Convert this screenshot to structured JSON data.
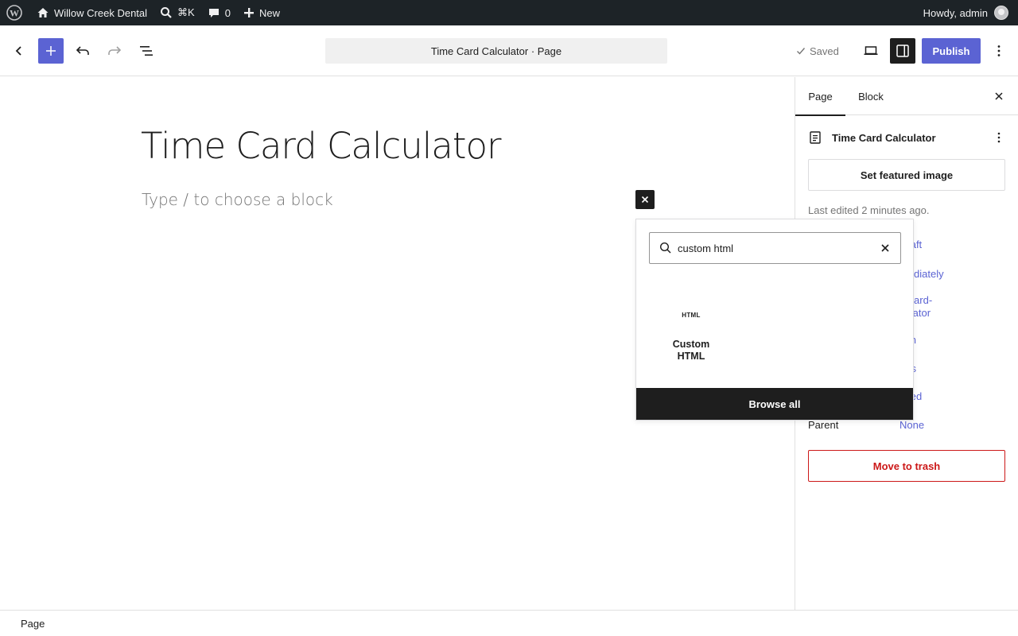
{
  "admin_bar": {
    "site_name": "Willow Creek Dental",
    "command_shortcut": "⌘K",
    "comments_count": "0",
    "new_label": "New",
    "howdy": "Howdy, admin"
  },
  "header": {
    "document_title": "Time Card Calculator · Page",
    "saved_label": "Saved",
    "publish_label": "Publish"
  },
  "canvas": {
    "page_title": "Time Card Calculator",
    "block_placeholder": "Type / to choose a block"
  },
  "inserter": {
    "search_value": "custom html",
    "result": {
      "icon_text": "HTML",
      "label": "Custom HTML"
    },
    "browse_all_label": "Browse all"
  },
  "sidebar": {
    "tabs": [
      "Page",
      "Block"
    ],
    "doc_name": "Time Card Calculator",
    "featured_image_label": "Set featured image",
    "last_edited": "Last edited 2 minutes ago.",
    "meta": [
      {
        "label": "",
        "value": "Draft"
      },
      {
        "label": "",
        "value": "mediately"
      },
      {
        "label": "",
        "value": "e-card-\nculator"
      },
      {
        "label": "",
        "value": "min"
      },
      {
        "label": "",
        "value": "ges"
      },
      {
        "label": "",
        "value": "osed"
      },
      {
        "label": "Parent",
        "value": "None"
      }
    ],
    "trash_label": "Move to trash"
  },
  "footer": {
    "breadcrumb": "Page"
  },
  "colors": {
    "accent": "#5b63d3",
    "admin_bar": "#1d2327",
    "danger": "#cc1818"
  }
}
